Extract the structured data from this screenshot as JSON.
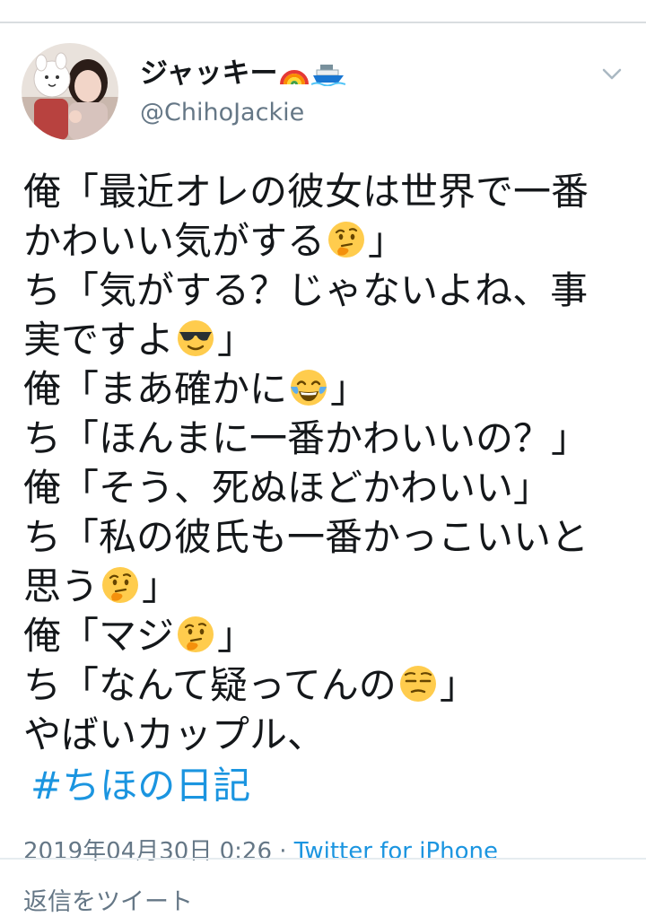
{
  "user": {
    "display_name": "ジャッキー",
    "name_emojis": [
      "rainbow-emoji",
      "ship-emoji"
    ],
    "handle": "@ChihoJackie"
  },
  "tweet": {
    "lines": [
      {
        "text": "俺「最近オレの彼女は世界で一番",
        "emoji": null,
        "tail": ""
      },
      {
        "text": "かわいい気がする",
        "emoji": "thinking-face",
        "tail": "」"
      },
      {
        "text": "ち「気がする？じゃないよね、事",
        "emoji": null,
        "tail": ""
      },
      {
        "text": "実ですよ",
        "emoji": "sunglasses-face",
        "tail": "」"
      },
      {
        "text": "俺「まあ確かに",
        "emoji": "tears-of-joy-face",
        "tail": "」"
      },
      {
        "text": "ち「ほんまに一番かわいいの？」",
        "emoji": null,
        "tail": ""
      },
      {
        "text": "俺「そう、死ぬほどかわいい」",
        "emoji": null,
        "tail": ""
      },
      {
        "text": "ち「私の彼氏も一番かっこいいと",
        "emoji": null,
        "tail": ""
      },
      {
        "text": "思う",
        "emoji": "thinking-face",
        "tail": "」"
      },
      {
        "text": "俺「マジ",
        "emoji": "thinking-face",
        "tail": "」"
      },
      {
        "text": "ち「なんて疑ってんの",
        "emoji": "unamused-face",
        "tail": "」"
      },
      {
        "text": "やばいカップル、",
        "emoji": null,
        "tail": ""
      }
    ],
    "hashtag": "#ちほの日記",
    "timestamp": "2019年04月30日 0:26",
    "separator": " · ",
    "source": "Twitter for iPhone"
  },
  "reply": {
    "placeholder": "返信をツイート"
  },
  "colors": {
    "link": "#1b95e0",
    "secondary_text": "#657786",
    "primary_text": "#14171a"
  }
}
